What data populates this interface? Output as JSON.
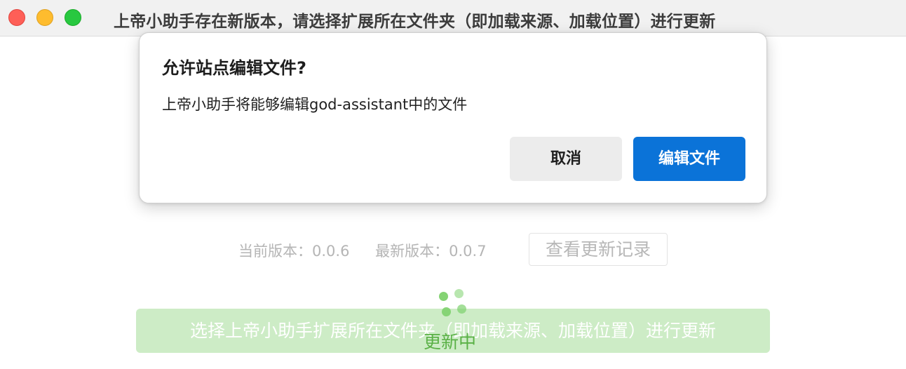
{
  "window": {
    "title": "上帝小助手存在新版本，请选择扩展所在文件夹（即加载来源、加载位置）进行更新"
  },
  "dialog": {
    "title": "允许站点编辑文件?",
    "message": "上帝小助手将能够编辑god-assistant中的文件",
    "cancel_label": "取消",
    "confirm_label": "编辑文件"
  },
  "content": {
    "current_version_label": "当前版本：0.0.6",
    "latest_version_label": "最新版本：0.0.7",
    "history_button_label": "查看更新记录",
    "select_folder_button_label": "选择上帝小助手扩展所在文件夹（即加载来源、加载位置）进行更新",
    "loading_text": "更新中"
  },
  "colors": {
    "primary_blue": "#0b73d8",
    "success_green": "#5ab146",
    "light_green": "#cdecc6"
  },
  "icons": {
    "spinner": "loading-spinner-icon"
  }
}
